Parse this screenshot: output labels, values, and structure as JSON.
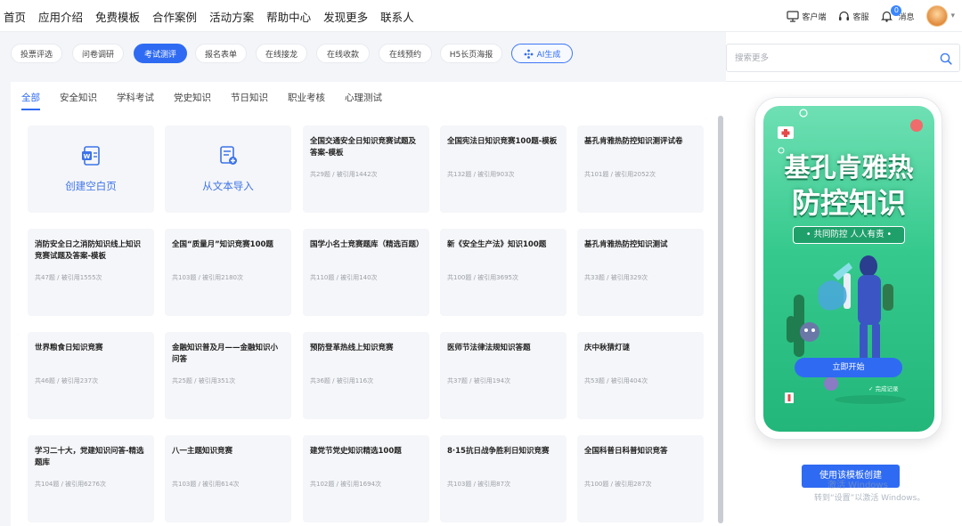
{
  "nav": {
    "links": [
      "首页",
      "应用介绍",
      "免费模板",
      "合作案例",
      "活动方案",
      "帮助中心",
      "发现更多",
      "联系人"
    ],
    "tools": {
      "client": "客户端",
      "service": "客服",
      "messages": "消息",
      "unread": "0"
    }
  },
  "categories": {
    "pills": [
      "投票评选",
      "问卷调研",
      "考试测评",
      "报名表单",
      "在线接龙",
      "在线收款",
      "在线预约",
      "H5长页海报"
    ],
    "active": "考试测评",
    "ai_label": "AI生成"
  },
  "subtabs": {
    "items": [
      "全部",
      "安全知识",
      "学科考试",
      "党史知识",
      "节日知识",
      "职业考核",
      "心理测试"
    ],
    "active": "全部"
  },
  "create": {
    "blank": "创建空白页",
    "import": "从文本导入"
  },
  "templates": [
    {
      "title": "全国交通安全日知识竞赛试题及答案-模板",
      "meta": "共29题 / 被引用1442次"
    },
    {
      "title": "全国宪法日知识竞赛100题-模板",
      "meta": "共132题 / 被引用903次"
    },
    {
      "title": "基孔肯雅热防控知识测评试卷",
      "meta": "共101题 / 被引用2052次"
    },
    {
      "title": "消防安全日之消防知识线上知识竞赛试题及答案-模板",
      "meta": "共47题 / 被引用1555次"
    },
    {
      "title": "全国“质量月”知识竞赛100题",
      "meta": "共103题 / 被引用2180次"
    },
    {
      "title": "国学小名士竞赛题库（精选百题）",
      "meta": "共110题 / 被引用140次"
    },
    {
      "title": "新《安全生产法》知识100题",
      "meta": "共100题 / 被引用3695次"
    },
    {
      "title": "基孔肯雅热防控知识测试",
      "meta": "共33题 / 被引用329次"
    },
    {
      "title": "世界粮食日知识竞赛",
      "meta": "共46题 / 被引用237次"
    },
    {
      "title": "金融知识普及月——金融知识小问答",
      "meta": "共25题 / 被引用351次"
    },
    {
      "title": "预防登革热线上知识竞赛",
      "meta": "共36题 / 被引用116次"
    },
    {
      "title": "医师节法律法规知识答题",
      "meta": "共37题 / 被引用194次"
    },
    {
      "title": "庆中秋猜灯谜",
      "meta": "共53题 / 被引用404次"
    },
    {
      "title": "学习二十大，党建知识问答-精选题库",
      "meta": "共104题 / 被引用6276次"
    },
    {
      "title": "八一主题知识竞赛",
      "meta": "共103题 / 被引用614次"
    },
    {
      "title": "建党节党史知识精选100题",
      "meta": "共102题 / 被引用1694次"
    },
    {
      "title": "8·15抗日战争胜利日知识竞赛",
      "meta": "共103题 / 被引用87次"
    },
    {
      "title": "全国科普日科普知识竞答",
      "meta": "共100题 / 被引用287次"
    }
  ],
  "search": {
    "placeholder": "搜索更多"
  },
  "preview": {
    "title_line1": "基孔肯雅热",
    "title_line2": "防控知识",
    "subtitle": "• 共同防控 人人有责 •",
    "start_button": "立即开始",
    "share_tag": "✓ 完成记录",
    "use_button": "使用该模板创建"
  },
  "watermark": {
    "line1": "激活 Windows",
    "line2": "转到“设置”以激活 Windows。"
  },
  "colors": {
    "accent": "#2f6bf2",
    "poster_green": "#35c98d"
  }
}
